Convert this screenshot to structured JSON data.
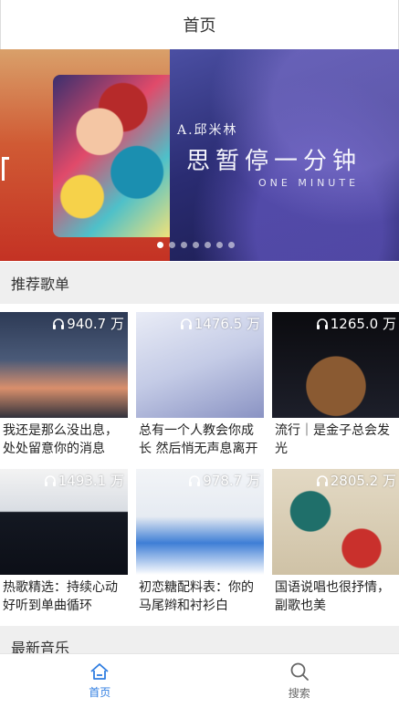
{
  "header": {
    "title": "首页"
  },
  "banner": {
    "artist_text": "A.邱米林",
    "title_text": "思暂停一分钟",
    "subtitle_text": "ONE MINUTE",
    "dot_count": 7,
    "active_dot": 0
  },
  "sections": {
    "recommended": "推荐歌单",
    "latest": "最新音乐"
  },
  "playlists": [
    {
      "count": "940.7 万",
      "title": "我还是那么没出息，处处留意你的消息"
    },
    {
      "count": "1476.5 万",
      "title": "总有一个人教会你成长 然后悄无声息离开"
    },
    {
      "count": "1265.0 万",
      "title": "流行｜是金子总会发光"
    },
    {
      "count": "1493.1 万",
      "title": "热歌精选：持续心动好听到单曲循环"
    },
    {
      "count": "978.7 万",
      "title": "初恋糖配料表：你的马尾辫和衬衫白"
    },
    {
      "count": "2805.2 万",
      "title": "国语说唱也很抒情，副歌也美"
    }
  ],
  "nav": {
    "home_label": "首页",
    "search_label": "搜索"
  },
  "colors": {
    "accent": "#2f7de1",
    "section_bg": "#efefef"
  }
}
